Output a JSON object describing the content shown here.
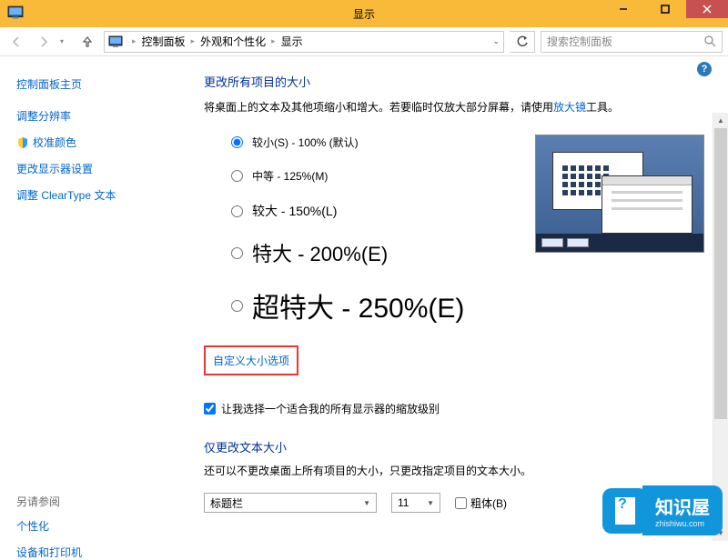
{
  "window": {
    "title": "显示"
  },
  "breadcrumb": {
    "items": [
      "控制面板",
      "外观和个性化",
      "显示"
    ]
  },
  "search": {
    "placeholder": "搜索控制面板"
  },
  "sidebar": {
    "home": "控制面板主页",
    "links": [
      "调整分辨率",
      "校准颜色",
      "更改显示器设置",
      "调整 ClearType 文本"
    ],
    "see_also_head": "另请参阅",
    "see_also": [
      "个性化",
      "设备和打印机"
    ]
  },
  "main": {
    "heading": "更改所有项目的大小",
    "desc_pre": "将桌面上的文本及其他项缩小和增大。若要临时仅放大部分屏幕，请使用",
    "desc_link": "放大镜",
    "desc_post": "工具。",
    "options": [
      {
        "label": "较小(S) - 100% (默认)",
        "checked": true,
        "size": ""
      },
      {
        "label": "中等 - 125%(M)",
        "checked": false,
        "size": ""
      },
      {
        "label": "较大 - 150%(L)",
        "checked": false,
        "size": "sz-l"
      },
      {
        "label": "特大 - 200%(E)",
        "checked": false,
        "size": "sz-xl"
      },
      {
        "label": "超特大 - 250%(E)",
        "checked": false,
        "size": "sz-xxl"
      }
    ],
    "custom_link": "自定义大小选项",
    "chk_label": "让我选择一个适合我的所有显示器的缩放级别",
    "sub_heading": "仅更改文本大小",
    "sub_desc": "还可以不更改桌面上所有项目的大小，只更改指定项目的文本大小。",
    "dd_item": "标题栏",
    "dd_size": "11",
    "bold_label": "粗体(B)"
  },
  "watermark": {
    "big": "知识屋",
    "small": "zhishiwu.com"
  }
}
